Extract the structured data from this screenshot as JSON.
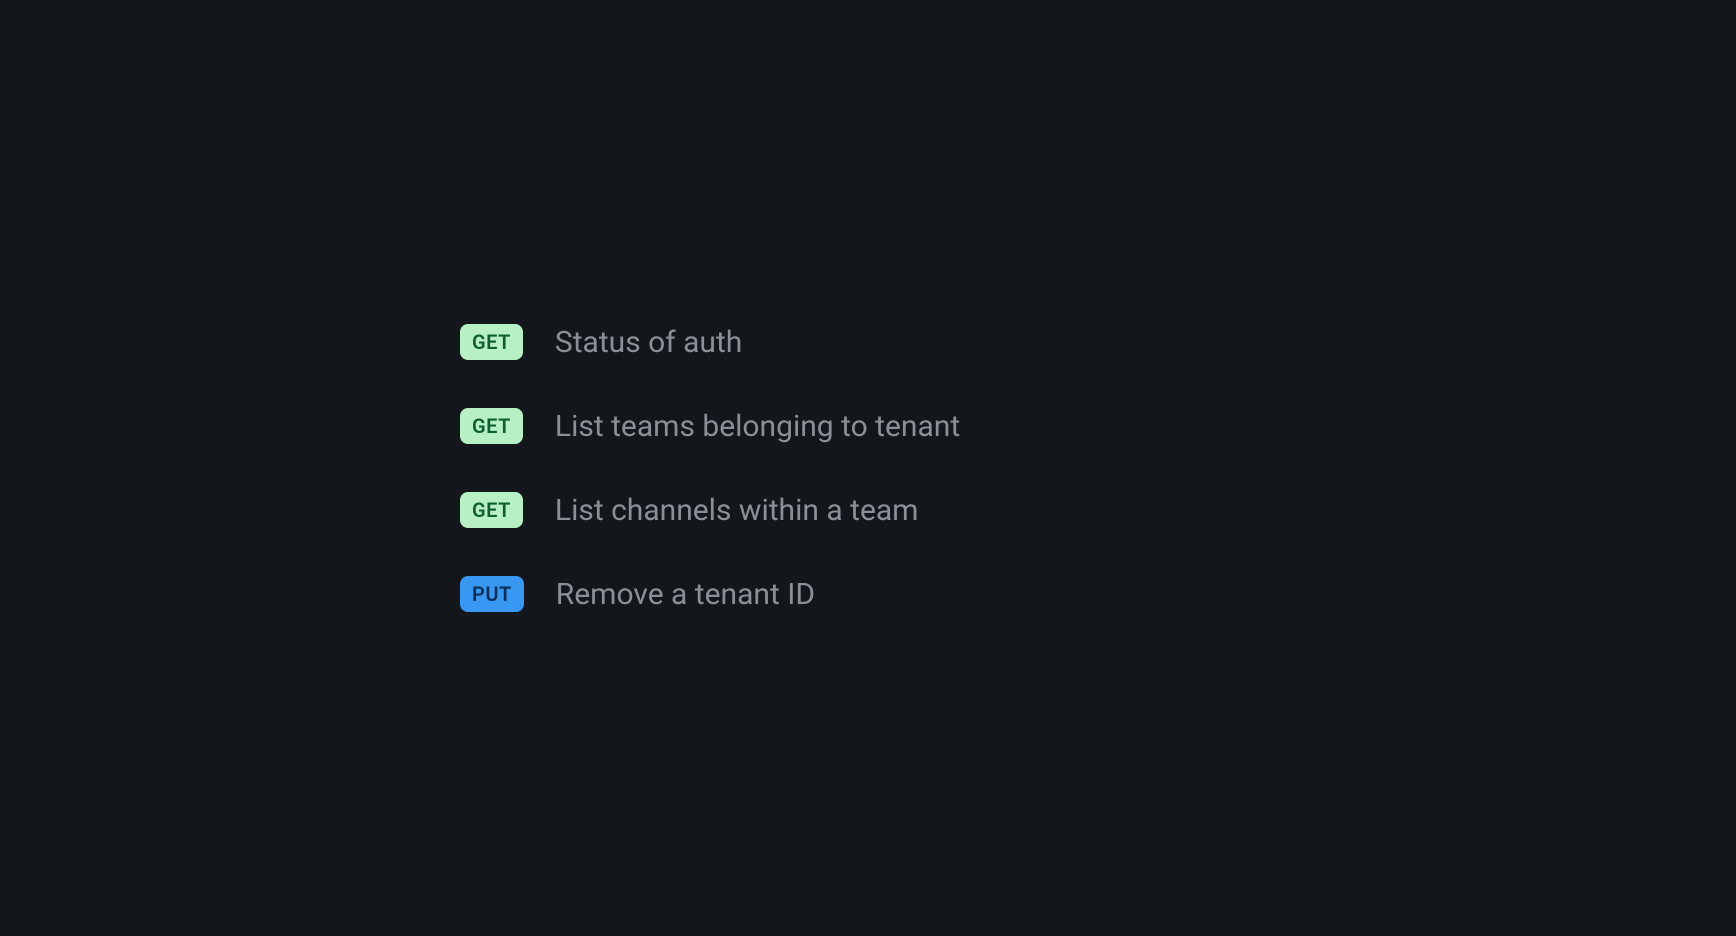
{
  "endpoints": [
    {
      "method": "GET",
      "label": "Status of auth"
    },
    {
      "method": "GET",
      "label": "List teams belonging to tenant"
    },
    {
      "method": "GET",
      "label": "List channels within a team"
    },
    {
      "method": "PUT",
      "label": "Remove a tenant ID"
    }
  ]
}
